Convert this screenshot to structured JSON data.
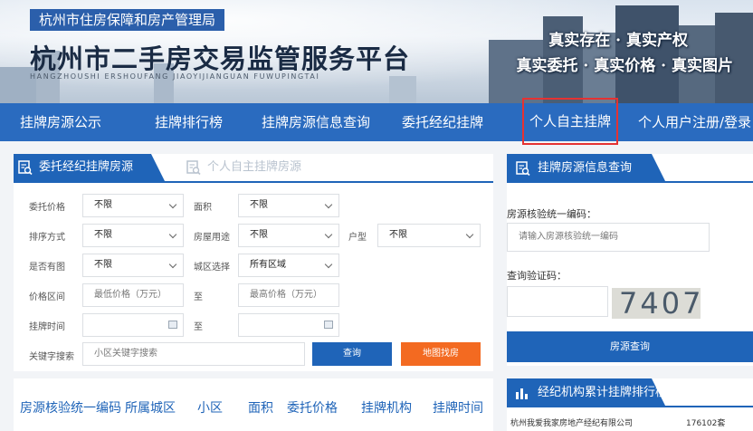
{
  "header": {
    "office": "杭州市住房保障和房产管理局",
    "title": "杭州市二手房交易监管服务平台",
    "subtitle": "HANGZHOUSHI ERSHOUFANG JIAOYIJIANGUAN FUWUPINGTAI",
    "slogan_line1": "真实存在 · 真实产权",
    "slogan_line2": "真实委托 · 真实价格 · 真实图片"
  },
  "nav": [
    {
      "label": "挂牌房源公示"
    },
    {
      "label": "挂牌排行榜"
    },
    {
      "label": "挂牌房源信息查询"
    },
    {
      "label": "委托经纪挂牌"
    },
    {
      "label": "个人自主挂牌",
      "active": true
    },
    {
      "label": "个人用户注册/登录"
    }
  ],
  "listing": {
    "tab_active": "委托经纪挂牌房源",
    "tab_inactive": "个人自主挂牌房源",
    "labels": {
      "price": "委托价格",
      "area": "面积",
      "sort": "排序方式",
      "usage": "房屋用途",
      "layout": "户型",
      "has_image": "是否有图",
      "district": "城区选择",
      "price_range": "价格区间",
      "to": "至",
      "list_time": "挂牌时间",
      "keyword": "关键字搜索"
    },
    "values": {
      "price": "不限",
      "area": "不限",
      "sort": "不限",
      "usage": "不限",
      "layout": "不限",
      "has_image": "不限",
      "district": "所有区域"
    },
    "placeholders": {
      "min_price": "最低价格（万元）",
      "max_price": "最高价格（万元）",
      "keyword": "小区关键字搜索"
    },
    "buttons": {
      "query": "查询",
      "map": "地图找房"
    },
    "button_colors": {
      "query": "#1f64b8",
      "map": "#f36a21"
    }
  },
  "table_header": [
    "房源核验统一编码",
    "所属城区",
    "小区",
    "面积",
    "委托价格",
    "挂牌机构",
    "挂牌时间"
  ],
  "query_panel": {
    "title": "挂牌房源信息查询",
    "code_label": "房源核验统一编码：",
    "code_placeholder": "请输入房源核验统一编码",
    "captcha_label": "查询验证码：",
    "captcha_text": "7407",
    "button": "房源查询"
  },
  "ranking": {
    "title": "经纪机构累计挂牌排行榜",
    "rows": [
      {
        "name": "杭州我爱我家房地产经纪有限公司",
        "count": "176102套"
      }
    ]
  },
  "colors": {
    "nav_bg": "#2a6bbf",
    "accent": "#1f64b8",
    "active_outline": "#e53232"
  }
}
